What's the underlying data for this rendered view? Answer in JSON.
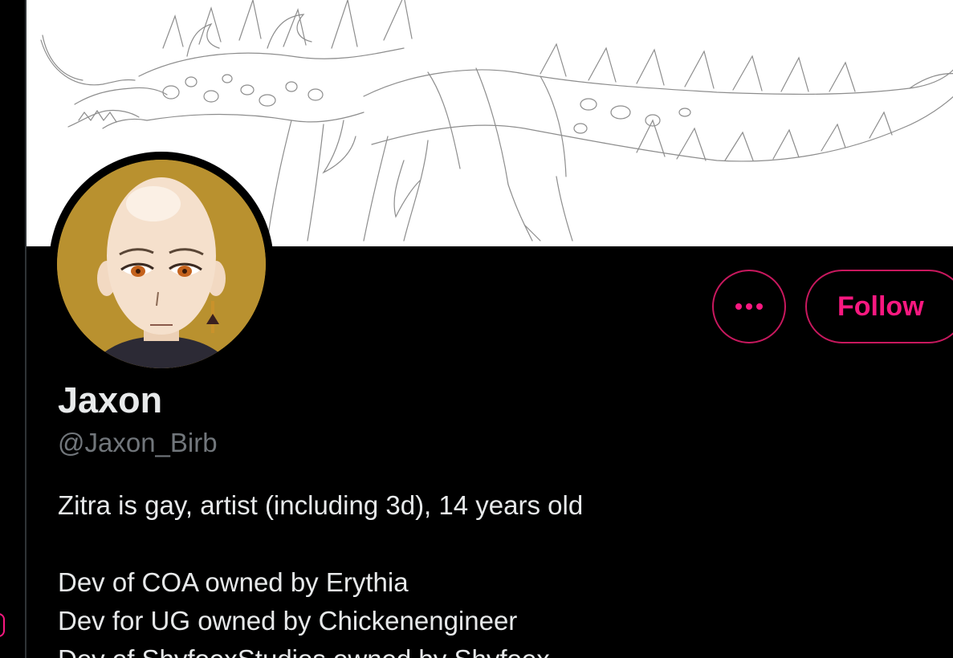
{
  "profile": {
    "display_name": "Jaxon",
    "handle": "@Jaxon_Birb",
    "bio_lines": [
      "Zitra is gay, artist (including 3d), 14 years old",
      "",
      "Dev of COA owned by Erythia",
      "Dev for UG owned by Chickenengineer",
      "Dev of ShyfoexStudios owned by Shyfoex"
    ]
  },
  "actions": {
    "more_icon": "ellipsis-icon",
    "follow_label": "Follow"
  },
  "colors": {
    "accent": "#f91880",
    "background": "#000000",
    "primary_text": "#e7e9ea",
    "secondary_text": "#71767b",
    "avatar_bg": "#b9912f"
  }
}
